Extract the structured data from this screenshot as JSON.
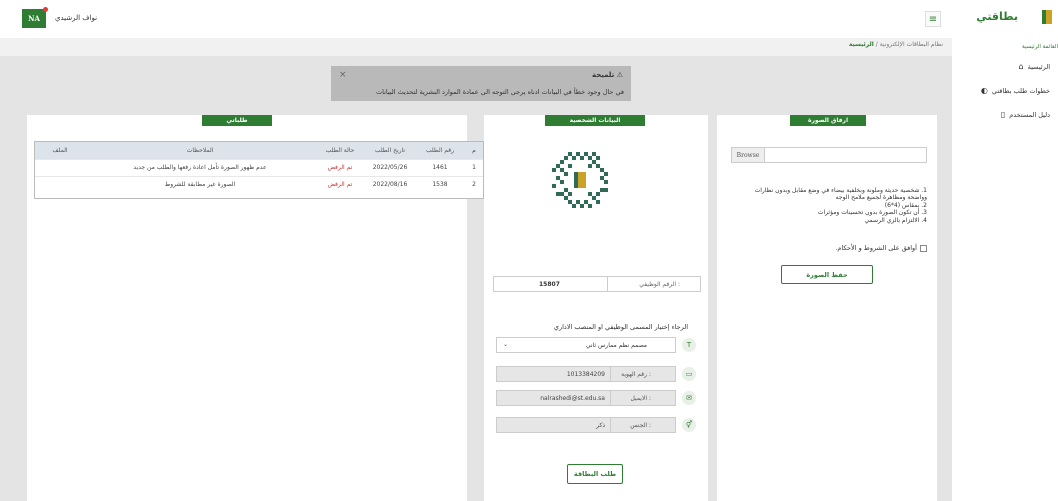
{
  "header": {
    "avatar_initials": "NA",
    "username": "نواف الرشيدي",
    "menu_icon": "hamburger-icon"
  },
  "breadcrumb": {
    "root": "نظام البطاقات الإلكترونية",
    "separator": "/",
    "current": "الرئيسية"
  },
  "alert": {
    "title": "تلميحة",
    "message": "في حال وجود خطأ في البيانات ادناه يرجى التوجه الى عمادة الموارد البشرية لتحديث البيانات",
    "close": "×"
  },
  "requests": {
    "title": "طلباتي",
    "columns": [
      "م",
      "رقم الطلب",
      "تاريخ الطلب",
      "حالة الطلب",
      "الملاحظات",
      "الملف"
    ],
    "rows": [
      {
        "idx": "1",
        "number": "1461",
        "date": "2022/05/26",
        "status": "تم الرفض",
        "note": "عدم ظهور الصورة تأمل اعادة رفعها والطلب من جديد",
        "file": ""
      },
      {
        "idx": "2",
        "number": "1538",
        "date": "2022/08/16",
        "status": "تم الرفض",
        "note": "الصورة غير مطابقة للشروط",
        "file": ""
      }
    ]
  },
  "personal": {
    "title": "البيانات الشخصية",
    "employee_label": "الرقم الوظيفي :",
    "employee_value": "15807",
    "choose_label": "الرجاء إختيار المسمى الوظيفي او المنصب الاداري",
    "job_select": "مصمم نظم ممارس ثاني",
    "id_label": "رقم الهوية :",
    "id_value": "1013384209",
    "email_label": "الايميل :",
    "email_value": "nalrashedi@st.edu.sa",
    "gender_label": "الجنس :",
    "gender_value": "ذكر",
    "request_button": "طلب البطاقة"
  },
  "upload": {
    "title": "ارفاق الصورة",
    "browse": "Browse",
    "rules": [
      "1. شخصية حديثة وملونة وبخلفية بيضاء في وضع مقابل وبدون نظارات وواضحة ومظاهرة لجميع ملامح الوجه",
      "2. بمقاس (4*6)",
      "3. أن تكون الصورة بدون تحسينات ومؤثرات",
      "4. الالتزام بالزي الرسمي"
    ],
    "agree_label": "أوافق على الشروط و الأحكام.",
    "save_button": "حفظ الصورة"
  },
  "sidebar": {
    "brand": "بطاقتي",
    "section": "القائمة الرئيسية",
    "items": [
      {
        "label": "الرئيسية",
        "icon": "home-icon"
      },
      {
        "label": "خطوات طلب بطاقتي",
        "icon": "steps-icon"
      },
      {
        "label": "دليل المستخدم",
        "icon": "book-icon"
      }
    ]
  },
  "colors": {
    "accent": "#2e7d32",
    "rejected": "#d32f2f",
    "alert_bg": "#b9b9b9"
  }
}
